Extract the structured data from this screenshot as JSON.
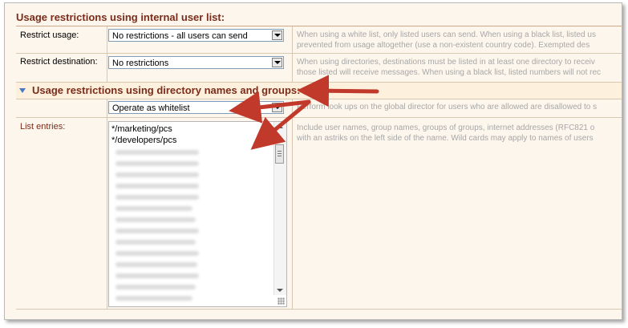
{
  "section1": {
    "title": "Usage restrictions using internal user list:"
  },
  "rows": {
    "restrict_usage": {
      "label": "Restrict usage:",
      "value": "No restrictions - all users can send",
      "help": [
        "When using a white list, only listed users can send. When using a black list, listed us",
        "prevented from usage altogether (use a non-existent country code). Exempted des"
      ]
    },
    "restrict_destination": {
      "label": "Restrict destination:",
      "value": "No restrictions",
      "help": [
        "When using directories, destinations must be listed in at least one directory to receiv",
        "those listed will receive messages. When using a black list, listed numbers will not rec"
      ]
    }
  },
  "section2": {
    "title": "Usage restrictions using directory names and groups:",
    "mode_value": "Operate as whitelist",
    "mode_help": "Perform look ups on the global director for users who are allowed are disallowed to s",
    "list_label": "List entries:",
    "list_items": [
      "*/marketing/pcs",
      "*/developers/pcs"
    ],
    "list_help": [
      "Include user names, group names, groups of groups, internet addresses (RFC821 o",
      "with an astriks on the left side of the name. Wild cards may apply to names of users"
    ]
  },
  "colors": {
    "accent": "#7b2c1b",
    "annotation_arrow": "#c0392b",
    "background": "#fdf6ec"
  },
  "icons": {
    "section_toggle": "chevron-down-icon",
    "dropdown": "chevron-down-icon"
  }
}
